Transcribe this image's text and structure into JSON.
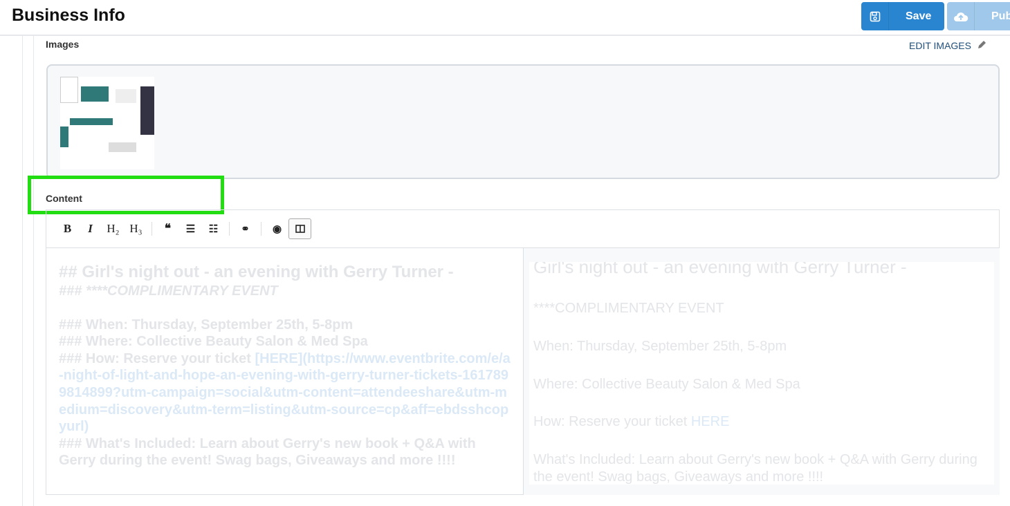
{
  "header": {
    "title": "Business Info",
    "save_label": "Save",
    "publish_label": "Pub"
  },
  "images": {
    "label": "Images",
    "edit_label": "EDIT IMAGES"
  },
  "content": {
    "label": "Content",
    "toolbar": [
      "B",
      "I",
      "H₂",
      "H₃"
    ],
    "markdown": {
      "l1": "## Girl's night out - an evening with Gerry Turner -",
      "l2": "### ****COMPLIMENTARY EVENT",
      "l3": "### When: Thursday,  September 25th, 5-8pm",
      "l4": "### Where: Collective Beauty Salon & Med Spa",
      "l5": "### How: Reserve your ticket ",
      "l5link": "[HERE](https://www.eventbrite.com/e/a-night-of-light-and-hope-an-evening-with-gerry-turner-tickets-1617899814899?utm-campaign=social&utm-content=attendeeshare&utm-medium=discovery&utm-term=listing&utm-source=cp&aff=ebdsshcopyurl)",
      "l6": "### What's Included: Learn about Gerry's new book + Q&A with Gerry during the event! Swag bags, Giveaways and more !!!!"
    },
    "preview": {
      "h": "Girl's night out - an evening with Gerry Turner -",
      "p1": "****COMPLIMENTARY EVENT",
      "p2": "When: Thursday, September 25th, 5-8pm",
      "p3": "Where: Collective Beauty Salon & Med Spa",
      "p4": "How: Reserve your ticket ",
      "p4link": "HERE",
      "p5": "What's Included: Learn about Gerry's new book + Q&A with Gerry during",
      "p6": "the event! Swag bags, Giveaways and more !!!!"
    }
  }
}
